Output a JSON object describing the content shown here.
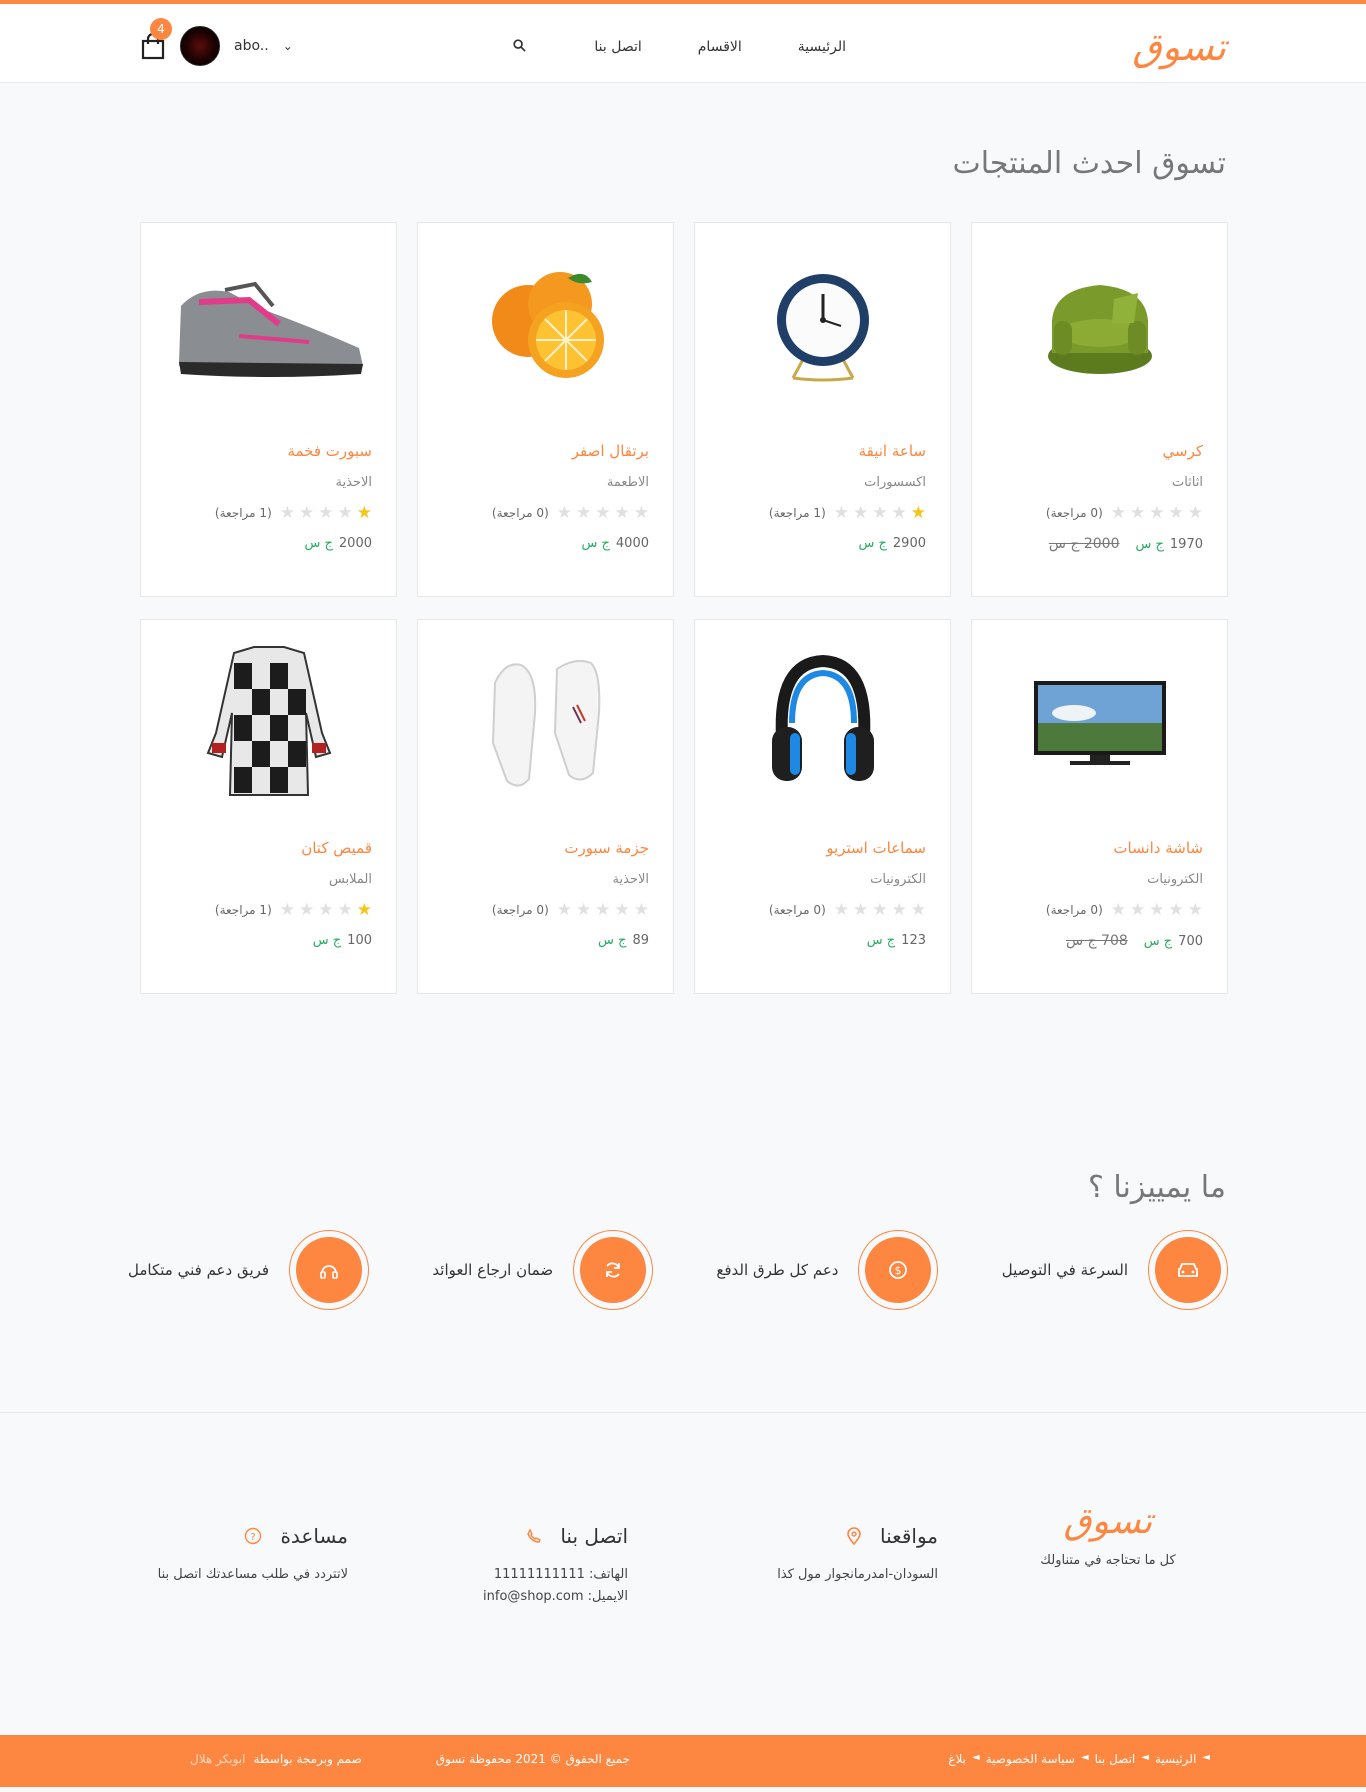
{
  "header": {
    "logo": "تسوق",
    "nav": [
      {
        "label": "الرئيسية"
      },
      {
        "label": "الاقسام"
      },
      {
        "label": "اتصل بنا"
      }
    ],
    "cart_count": "4",
    "user_name": "abo..",
    "accent": "#fd8640"
  },
  "latest": {
    "title": "تسوق احدث المنتجات",
    "products": [
      {
        "name": "كرسي",
        "category": "اثاثات",
        "rating": 0,
        "reviews": "(0 مراجعة)",
        "price": "1970",
        "old_price": "2000 ج س",
        "image": "armchair"
      },
      {
        "name": "ساعة انيقة",
        "category": "اكسسورات",
        "rating": 0.5,
        "reviews": "(1 مراجعة)",
        "price": "2900",
        "old_price": "",
        "image": "clock"
      },
      {
        "name": "برتقال اصفر",
        "category": "الاطعمة",
        "rating": 0,
        "reviews": "(0 مراجعة)",
        "price": "4000",
        "old_price": "",
        "image": "orange"
      },
      {
        "name": "سبورت فخمة",
        "category": "الاحذية",
        "rating": 0.5,
        "reviews": "(1 مراجعة)",
        "price": "2000",
        "old_price": "",
        "image": "sneaker"
      },
      {
        "name": "شاشة دانسات",
        "category": "الكترونيات",
        "rating": 0,
        "reviews": "(0 مراجعة)",
        "price": "700",
        "old_price": "708 ج س",
        "image": "tv"
      },
      {
        "name": "سماعات استريو",
        "category": "الكترونيات",
        "rating": 0,
        "reviews": "(0 مراجعة)",
        "price": "123",
        "old_price": "",
        "image": "headphones"
      },
      {
        "name": "جزمة سبورت",
        "category": "الاحذية",
        "rating": 0,
        "reviews": "(0 مراجعة)",
        "price": "89",
        "old_price": "",
        "image": "white-shoes"
      },
      {
        "name": "قميص كتان",
        "category": "الملابس",
        "rating": 0.5,
        "reviews": "(1 مراجعة)",
        "price": "100",
        "old_price": "",
        "image": "shirt"
      }
    ],
    "currency": "ج س"
  },
  "features": {
    "title": "ما يمييزنا ؟",
    "items": [
      {
        "label": "السرعة في التوصيل",
        "icon": "car-icon"
      },
      {
        "label": "دعم كل طرق الدفع",
        "icon": "dollar-icon"
      },
      {
        "label": "ضمان ارجاع العوائد",
        "icon": "refresh-icon"
      },
      {
        "label": "فريق دعم فني متكامل",
        "icon": "headphones-icon"
      }
    ]
  },
  "footer": {
    "logo": "تسوق",
    "tagline": "كل ما تحتاجه في متناولك",
    "locations_title": "مواقعنا",
    "locations_text": "السودان-امدرمانجوار مول كذا",
    "contact_title": "اتصل بنا",
    "contact_phone": "الهاتف: 11111111111",
    "contact_email": "الايميل: info@shop.com",
    "help_title": "مساعدة",
    "help_text": "لاتتردد في طلب مساعدتك اتصل بنا"
  },
  "bottom": {
    "links": [
      "الرئيسية",
      "اتصل بنا",
      "سياسة الخصوصية",
      "بلاغ"
    ],
    "copyright": "جميع الحقوق © 2021 محفوظة تسوق",
    "designed_by": "صمم وبرمجة بواسطة",
    "author": "ابوبكر هلال"
  }
}
